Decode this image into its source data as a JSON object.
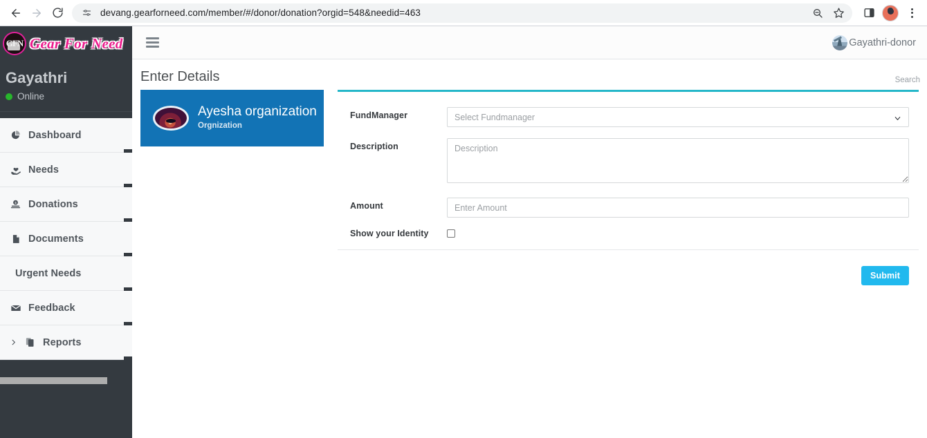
{
  "browser": {
    "back_icon": "arrow-left-icon",
    "forward_icon": "arrow-right-icon",
    "reload_icon": "reload-icon",
    "site_info_icon": "site-settings-icon",
    "url": "devang.gearforneed.com/member/#/donor/donation?orgid=548&needid=463",
    "url_host": "devang.gearforneed.com",
    "url_path": "/member/#/donor/donation?orgid=548&needid=463",
    "zoom_icon": "zoom-out-icon",
    "bookmark_icon": "star-icon",
    "side_panel_icon": "side-panel-icon",
    "profile_icon": "profile-avatar-icon",
    "menu_icon": "three-dot-menu-icon"
  },
  "sidebar": {
    "brand": {
      "logo_icon": "gear-for-need-logo-icon",
      "logo_initials": "GFN",
      "name": "Gear For Need"
    },
    "user": {
      "name": "Gayathri",
      "status": "Online",
      "status_color": "#28b62c"
    },
    "items": [
      {
        "label": "Dashboard",
        "icon": "pie-chart-icon",
        "has_icon": true,
        "has_caret": false
      },
      {
        "label": "Needs",
        "icon": "hand-heart-icon",
        "has_icon": true,
        "has_caret": false
      },
      {
        "label": "Donations",
        "icon": "donation-box-icon",
        "has_icon": true,
        "has_caret": false
      },
      {
        "label": "Documents",
        "icon": "file-icon",
        "has_icon": true,
        "has_caret": false
      },
      {
        "label": "Urgent Needs",
        "icon": "",
        "has_icon": false,
        "has_caret": false
      },
      {
        "label": "Feedback",
        "icon": "envelope-icon",
        "has_icon": true,
        "has_caret": false
      },
      {
        "label": "Reports",
        "icon": "copy-files-icon",
        "has_icon": true,
        "has_caret": true
      }
    ],
    "background_color": "#343a40",
    "item_background_color": "#f7f8f9"
  },
  "topbar": {
    "menu_toggle_icon": "hamburger-menu-icon",
    "user_label": "Gayathri-donor",
    "user_avatar_icon": "user-avatar-icon"
  },
  "page": {
    "title": "Enter Details",
    "search_label": "Search"
  },
  "org_card": {
    "avatar_icon": "organization-avatar-icon",
    "name": "Ayesha organization",
    "subtitle": "Orgnization",
    "background_color": "#1273b5"
  },
  "form": {
    "accent_color": "#25b7c9",
    "fundmanager": {
      "label": "FundManager",
      "value": "Select Fundmanager",
      "options": [
        "Select Fundmanager"
      ],
      "chevron_icon": "chevron-down-icon"
    },
    "description": {
      "label": "Description",
      "value": "",
      "placeholder": "Description"
    },
    "amount": {
      "label": "Amount",
      "value": "",
      "placeholder": "Enter Amount"
    },
    "identity": {
      "label": "Show your Identity",
      "checked": false
    },
    "submit_label": "Submit",
    "submit_color": "#21b9ee"
  }
}
